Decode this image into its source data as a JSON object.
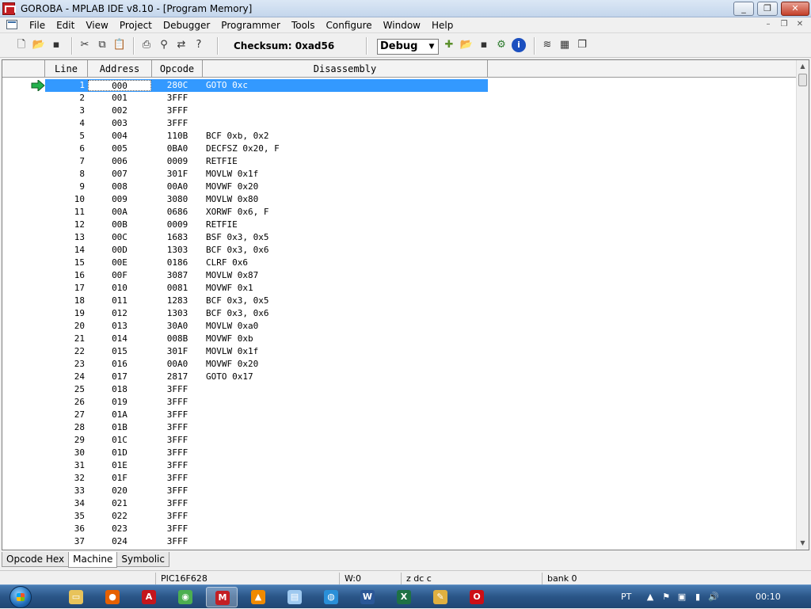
{
  "window": {
    "title": "GOROBA - MPLAB IDE v8.10 - [Program Memory]",
    "minimize": "_",
    "restore": "❐",
    "close": "✕"
  },
  "menu": {
    "items": [
      "File",
      "Edit",
      "View",
      "Project",
      "Debugger",
      "Programmer",
      "Tools",
      "Configure",
      "Window",
      "Help"
    ],
    "mdi_min": "–",
    "mdi_restore": "❐",
    "mdi_close": "✕"
  },
  "toolbar": {
    "checksum": "Checksum: 0xad56",
    "build_mode": "Debug",
    "icons": [
      "new-file-icon",
      "open-folder-icon",
      "save-icon",
      "cut-icon",
      "copy-icon",
      "paste-icon",
      "print-icon",
      "find-icon",
      "replace-icon",
      "help-icon",
      "new-project-icon",
      "open-project-icon",
      "save-project-icon",
      "project-settings-icon",
      "info-icon",
      "layer-icon",
      "grid-icon",
      "window-icon"
    ]
  },
  "table": {
    "headers": {
      "line": "Line",
      "address": "Address",
      "opcode": "Opcode",
      "disassembly": "Disassembly"
    },
    "rows": [
      {
        "line": "1",
        "address": "000",
        "opcode": "280C",
        "disassembly": "GOTO 0xc",
        "selected": true
      },
      {
        "line": "2",
        "address": "001",
        "opcode": "3FFF",
        "disassembly": ""
      },
      {
        "line": "3",
        "address": "002",
        "opcode": "3FFF",
        "disassembly": ""
      },
      {
        "line": "4",
        "address": "003",
        "opcode": "3FFF",
        "disassembly": ""
      },
      {
        "line": "5",
        "address": "004",
        "opcode": "110B",
        "disassembly": "BCF 0xb, 0x2"
      },
      {
        "line": "6",
        "address": "005",
        "opcode": "0BA0",
        "disassembly": "DECFSZ 0x20, F"
      },
      {
        "line": "7",
        "address": "006",
        "opcode": "0009",
        "disassembly": "RETFIE"
      },
      {
        "line": "8",
        "address": "007",
        "opcode": "301F",
        "disassembly": "MOVLW 0x1f"
      },
      {
        "line": "9",
        "address": "008",
        "opcode": "00A0",
        "disassembly": "MOVWF 0x20"
      },
      {
        "line": "10",
        "address": "009",
        "opcode": "3080",
        "disassembly": "MOVLW 0x80"
      },
      {
        "line": "11",
        "address": "00A",
        "opcode": "0686",
        "disassembly": "XORWF 0x6, F"
      },
      {
        "line": "12",
        "address": "00B",
        "opcode": "0009",
        "disassembly": "RETFIE"
      },
      {
        "line": "13",
        "address": "00C",
        "opcode": "1683",
        "disassembly": "BSF 0x3, 0x5"
      },
      {
        "line": "14",
        "address": "00D",
        "opcode": "1303",
        "disassembly": "BCF 0x3, 0x6"
      },
      {
        "line": "15",
        "address": "00E",
        "opcode": "0186",
        "disassembly": "CLRF 0x6"
      },
      {
        "line": "16",
        "address": "00F",
        "opcode": "3087",
        "disassembly": "MOVLW 0x87"
      },
      {
        "line": "17",
        "address": "010",
        "opcode": "0081",
        "disassembly": "MOVWF 0x1"
      },
      {
        "line": "18",
        "address": "011",
        "opcode": "1283",
        "disassembly": "BCF 0x3, 0x5"
      },
      {
        "line": "19",
        "address": "012",
        "opcode": "1303",
        "disassembly": "BCF 0x3, 0x6"
      },
      {
        "line": "20",
        "address": "013",
        "opcode": "30A0",
        "disassembly": "MOVLW 0xa0"
      },
      {
        "line": "21",
        "address": "014",
        "opcode": "008B",
        "disassembly": "MOVWF 0xb"
      },
      {
        "line": "22",
        "address": "015",
        "opcode": "301F",
        "disassembly": "MOVLW 0x1f"
      },
      {
        "line": "23",
        "address": "016",
        "opcode": "00A0",
        "disassembly": "MOVWF 0x20"
      },
      {
        "line": "24",
        "address": "017",
        "opcode": "2817",
        "disassembly": "GOTO 0x17"
      },
      {
        "line": "25",
        "address": "018",
        "opcode": "3FFF",
        "disassembly": ""
      },
      {
        "line": "26",
        "address": "019",
        "opcode": "3FFF",
        "disassembly": ""
      },
      {
        "line": "27",
        "address": "01A",
        "opcode": "3FFF",
        "disassembly": ""
      },
      {
        "line": "28",
        "address": "01B",
        "opcode": "3FFF",
        "disassembly": ""
      },
      {
        "line": "29",
        "address": "01C",
        "opcode": "3FFF",
        "disassembly": ""
      },
      {
        "line": "30",
        "address": "01D",
        "opcode": "3FFF",
        "disassembly": ""
      },
      {
        "line": "31",
        "address": "01E",
        "opcode": "3FFF",
        "disassembly": ""
      },
      {
        "line": "32",
        "address": "01F",
        "opcode": "3FFF",
        "disassembly": ""
      },
      {
        "line": "33",
        "address": "020",
        "opcode": "3FFF",
        "disassembly": ""
      },
      {
        "line": "34",
        "address": "021",
        "opcode": "3FFF",
        "disassembly": ""
      },
      {
        "line": "35",
        "address": "022",
        "opcode": "3FFF",
        "disassembly": ""
      },
      {
        "line": "36",
        "address": "023",
        "opcode": "3FFF",
        "disassembly": ""
      },
      {
        "line": "37",
        "address": "024",
        "opcode": "3FFF",
        "disassembly": ""
      }
    ]
  },
  "tabs": [
    {
      "label": "Opcode Hex",
      "active": false
    },
    {
      "label": "Machine",
      "active": true
    },
    {
      "label": "Symbolic",
      "active": false
    }
  ],
  "status": {
    "device": "PIC16F628",
    "w_reg": "W:0",
    "flags": "z dc c",
    "bank": "bank 0"
  },
  "taskbar": {
    "apps": [
      "explorer",
      "firefox",
      "acrobat",
      "chrome",
      "mplab",
      "vlc",
      "notepad",
      "network",
      "word",
      "excel",
      "paint",
      "opera"
    ],
    "active_app": "mplab",
    "language": "PT",
    "clock": "00:10"
  },
  "colors": {
    "selection": "#3399ff",
    "pc_arrow": "#22b14c"
  }
}
